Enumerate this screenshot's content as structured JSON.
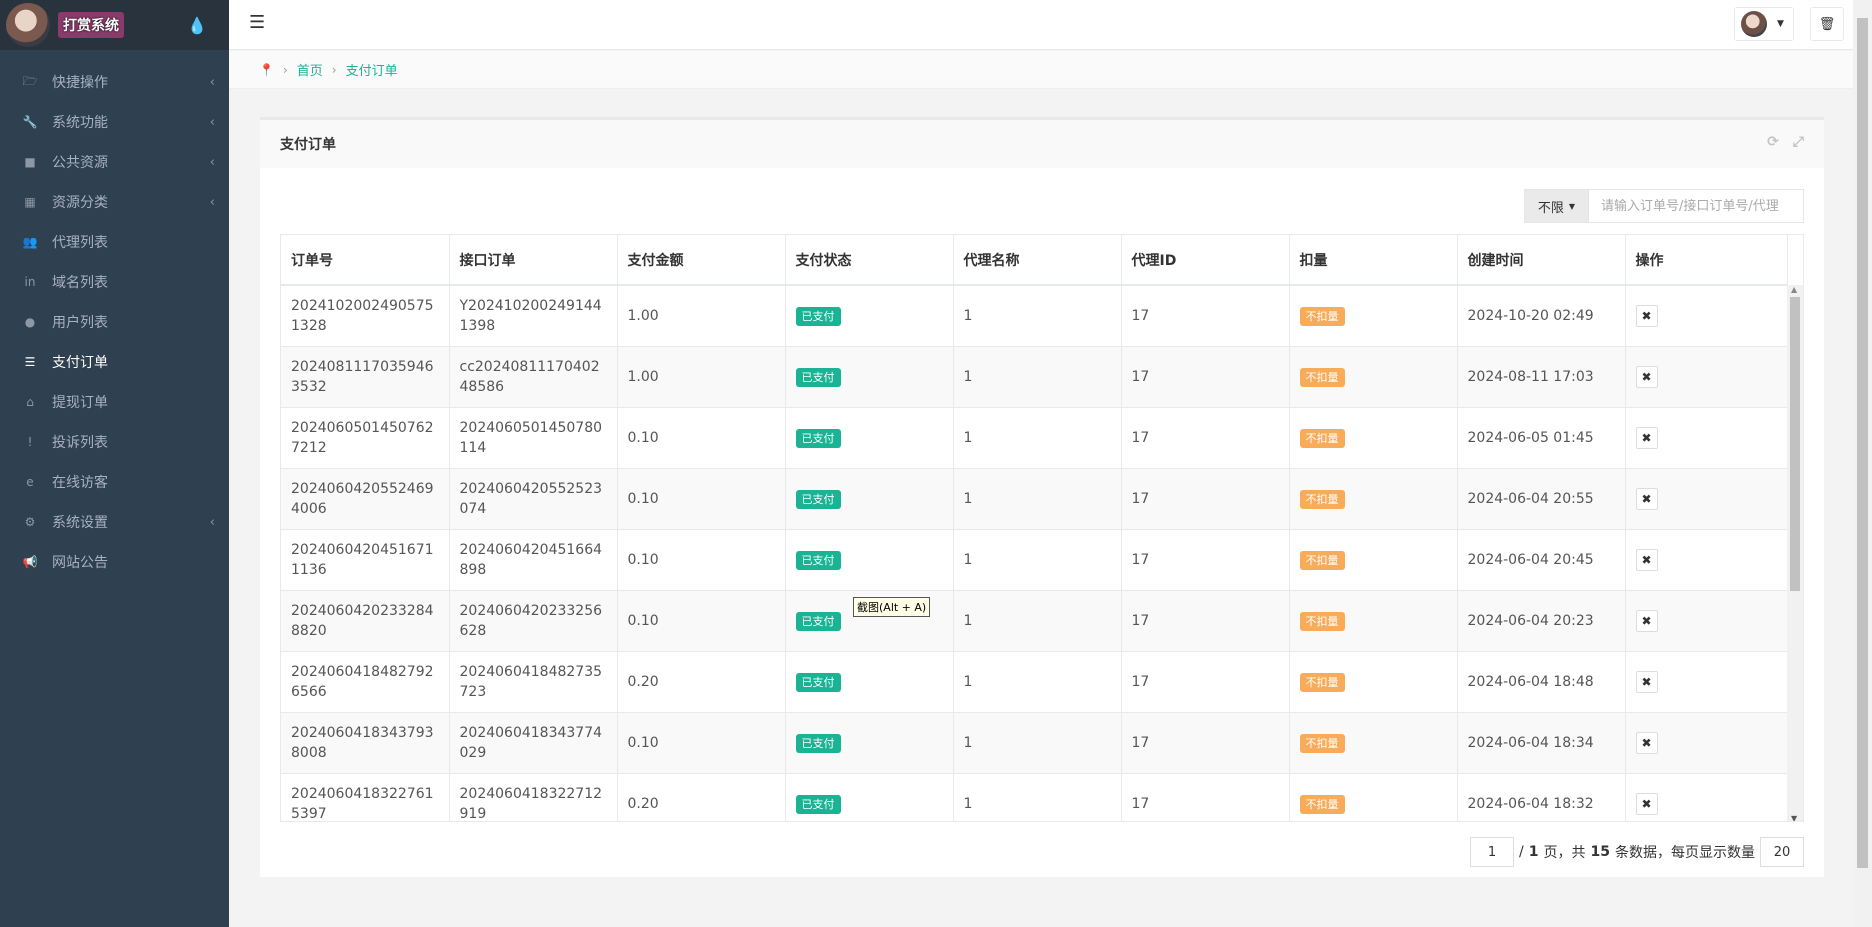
{
  "brand": {
    "title": "打赏系统"
  },
  "sidebar": {
    "items": [
      {
        "label": "快捷操作",
        "icon": "folder-open-icon",
        "glyph": "🗁",
        "arrow": "‹",
        "active": false
      },
      {
        "label": "系统功能",
        "icon": "wrench-icon",
        "glyph": "🔧",
        "arrow": "‹",
        "active": false
      },
      {
        "label": "公共资源",
        "icon": "video-camera-icon",
        "glyph": "■",
        "arrow": "‹",
        "active": false
      },
      {
        "label": "资源分类",
        "icon": "th-icon",
        "glyph": "▦",
        "arrow": "‹",
        "active": false
      },
      {
        "label": "代理列表",
        "icon": "users-icon",
        "glyph": "👥",
        "arrow": "",
        "active": false
      },
      {
        "label": "域名列表",
        "icon": "linkedin-icon",
        "glyph": "in",
        "arrow": "",
        "active": false
      },
      {
        "label": "用户列表",
        "icon": "user-icon",
        "glyph": "●",
        "arrow": "",
        "active": false
      },
      {
        "label": "支付订单",
        "icon": "database-icon",
        "glyph": "☰",
        "arrow": "",
        "active": true
      },
      {
        "label": "提现订单",
        "icon": "bank-icon",
        "glyph": "⌂",
        "arrow": "",
        "active": false
      },
      {
        "label": "投诉列表",
        "icon": "exclamation-circle-icon",
        "glyph": "!",
        "arrow": "",
        "active": false
      },
      {
        "label": "在线访客",
        "icon": "ie-icon",
        "glyph": "e",
        "arrow": "",
        "active": false
      },
      {
        "label": "系统设置",
        "icon": "gear-icon",
        "glyph": "⚙",
        "arrow": "‹",
        "active": false
      },
      {
        "label": "网站公告",
        "icon": "bullhorn-icon",
        "glyph": "📢",
        "arrow": "",
        "active": false
      }
    ]
  },
  "breadcrumb": {
    "home": "首页",
    "current": "支付订单"
  },
  "panel": {
    "title": "支付订单",
    "filter_label": "不限",
    "search_placeholder": "请输入订单号/接口订单号/代理"
  },
  "table": {
    "headers": [
      "订单号",
      "接口订单",
      "支付金额",
      "支付状态",
      "代理名称",
      "代理ID",
      "扣量",
      "创建时间",
      "操作"
    ],
    "rows": [
      {
        "order_no": "20241020024905751328",
        "api_order": "Y2024102002491441398",
        "amount": "1.00",
        "status": "已支付",
        "agent_name": "1",
        "agent_id": "17",
        "deduct": "不扣量",
        "created": "2024-10-20 02:49"
      },
      {
        "order_no": "20240811170359463532",
        "api_order": "cc2024081117040248586",
        "amount": "1.00",
        "status": "已支付",
        "agent_name": "1",
        "agent_id": "17",
        "deduct": "不扣量",
        "created": "2024-08-11 17:03"
      },
      {
        "order_no": "20240605014507627212",
        "api_order": "2024060501450780114",
        "amount": "0.10",
        "status": "已支付",
        "agent_name": "1",
        "agent_id": "17",
        "deduct": "不扣量",
        "created": "2024-06-05 01:45"
      },
      {
        "order_no": "20240604205524694006",
        "api_order": "2024060420552523074",
        "amount": "0.10",
        "status": "已支付",
        "agent_name": "1",
        "agent_id": "17",
        "deduct": "不扣量",
        "created": "2024-06-04 20:55"
      },
      {
        "order_no": "20240604204516711136",
        "api_order": "2024060420451664898",
        "amount": "0.10",
        "status": "已支付",
        "agent_name": "1",
        "agent_id": "17",
        "deduct": "不扣量",
        "created": "2024-06-04 20:45"
      },
      {
        "order_no": "20240604202332848820",
        "api_order": "2024060420233256628",
        "amount": "0.10",
        "status": "已支付",
        "agent_name": "1",
        "agent_id": "17",
        "deduct": "不扣量",
        "created": "2024-06-04 20:23"
      },
      {
        "order_no": "20240604184827926566",
        "api_order": "2024060418482735723",
        "amount": "0.20",
        "status": "已支付",
        "agent_name": "1",
        "agent_id": "17",
        "deduct": "不扣量",
        "created": "2024-06-04 18:48"
      },
      {
        "order_no": "20240604183437938008",
        "api_order": "2024060418343774029",
        "amount": "0.10",
        "status": "已支付",
        "agent_name": "1",
        "agent_id": "17",
        "deduct": "不扣量",
        "created": "2024-06-04 18:34"
      },
      {
        "order_no": "20240604183227615397",
        "api_order": "2024060418322712919",
        "amount": "0.20",
        "status": "已支付",
        "agent_name": "1",
        "agent_id": "17",
        "deduct": "不扣量",
        "created": "2024-06-04 18:32"
      }
    ],
    "delete_glyph": "✖"
  },
  "pager": {
    "current_page": "1",
    "slash": "/",
    "total_pages": "1",
    "page_word": "页，共",
    "total_count": "15",
    "count_suffix": "条数据，每页显示数量",
    "page_size": "20"
  },
  "tooltip": "截图(Alt + A)",
  "colors": {
    "sidebar_bg": "#2f4050",
    "accent": "#1ab394",
    "warning": "#f8ac59"
  }
}
